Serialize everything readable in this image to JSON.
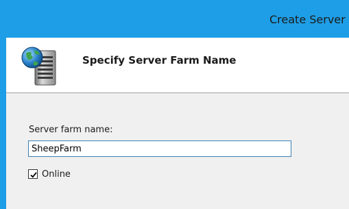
{
  "window": {
    "title": "Create Server F"
  },
  "header": {
    "icon": "server-globe-icon",
    "title": "Specify Server Farm Name"
  },
  "form": {
    "name_label": "Server farm name:",
    "name_value": "SheepFarm",
    "online_label": "Online",
    "online_checked": true
  },
  "colors": {
    "title_bar": "#1e9ee6",
    "content_bg": "#f0f0f0",
    "input_border": "#3c7fb1"
  }
}
